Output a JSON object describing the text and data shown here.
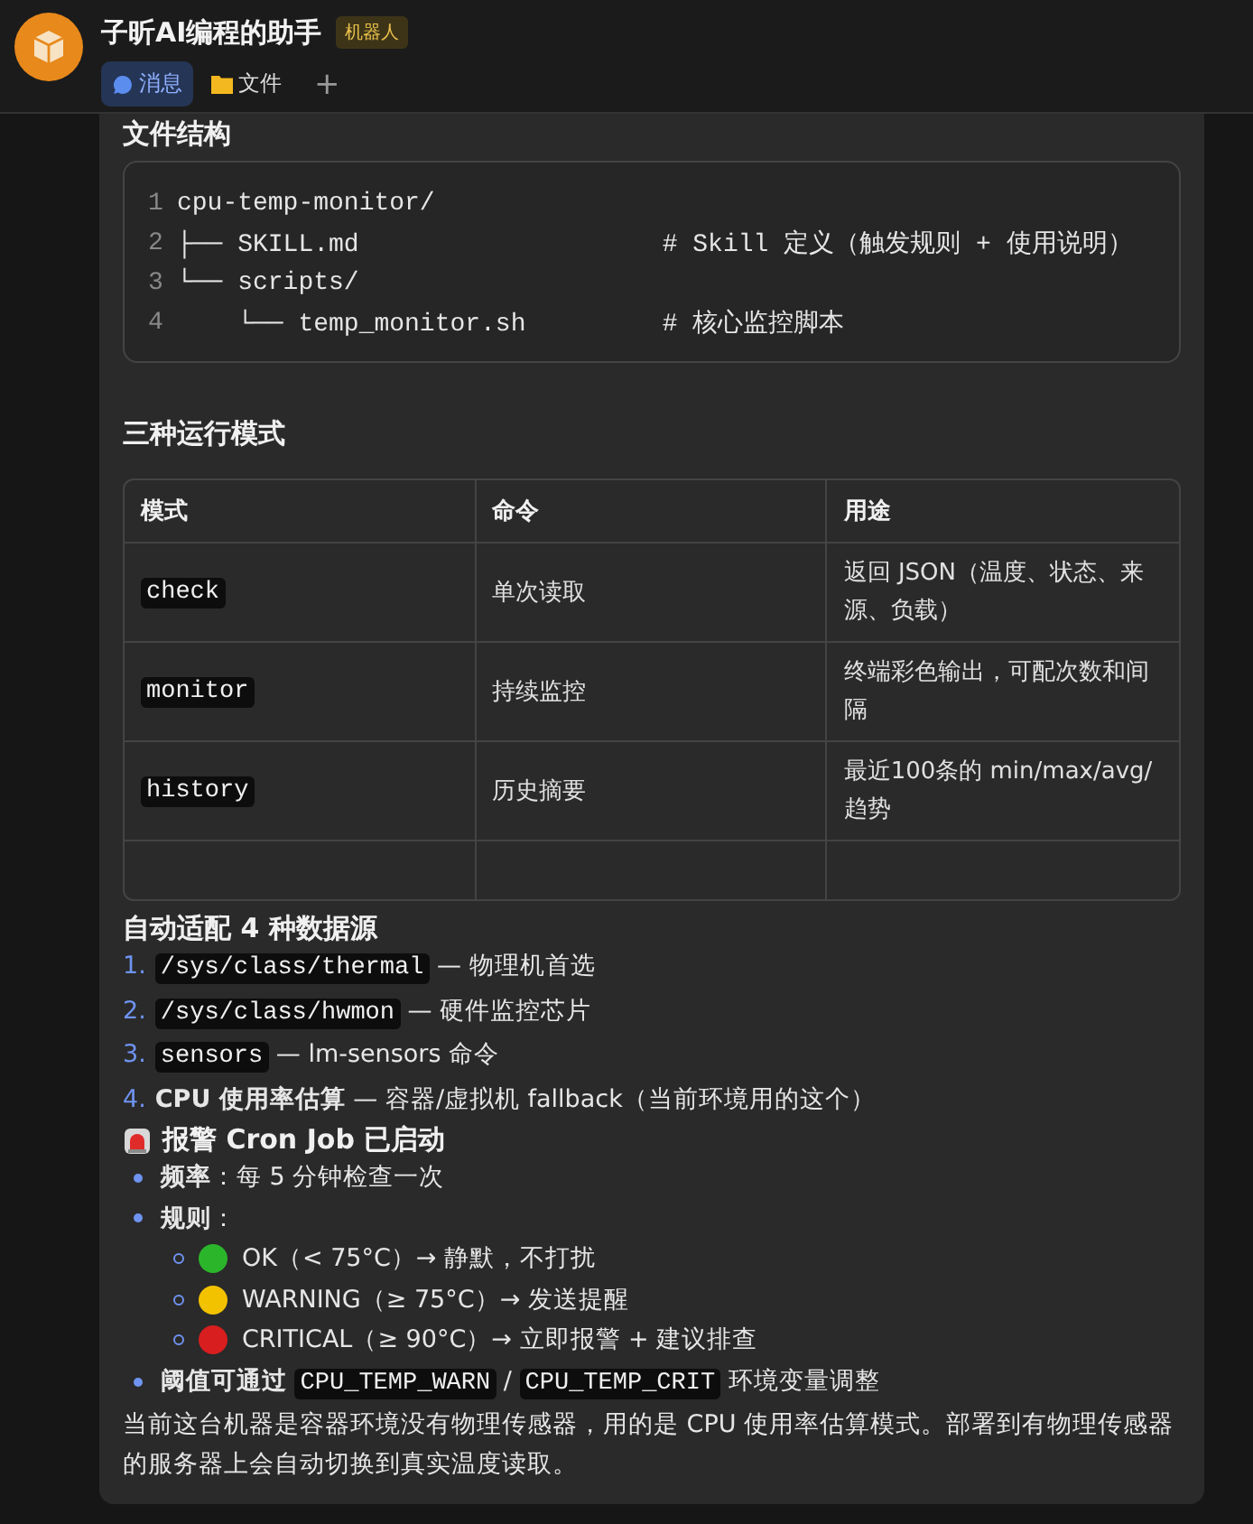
{
  "header": {
    "title": "子昕AI编程的助手",
    "badge": "机器人",
    "tabs": [
      {
        "label": "消息",
        "kind": "chat",
        "selected": true
      },
      {
        "label": "文件",
        "kind": "folder",
        "selected": false
      }
    ],
    "add_tab": "+"
  },
  "file_structure": {
    "heading": "文件结构",
    "lines": [
      {
        "number": "1",
        "text": "cpu-temp-monitor/"
      },
      {
        "number": "2",
        "text": "├── SKILL.md                    # Skill 定义（触发规则 + 使用说明）"
      },
      {
        "number": "3",
        "text": "└── scripts/"
      },
      {
        "number": "4",
        "text": "    └── temp_monitor.sh         # 核心监控脚本"
      }
    ]
  },
  "modes": {
    "heading": "三种运行模式",
    "columns": [
      "模式",
      "命令",
      "用途"
    ],
    "rows": [
      {
        "mode": "check",
        "command": "单次读取",
        "purpose": "返回 JSON（温度、状态、来源、负载）"
      },
      {
        "mode": "monitor",
        "command": "持续监控",
        "purpose": "终端彩色输出，可配次数和间隔"
      },
      {
        "mode": "history",
        "command": "历史摘要",
        "purpose": "最近100条的 min/max/avg/趋势"
      }
    ]
  },
  "sources": {
    "heading": "自动适配 4 种数据源",
    "items": [
      {
        "number": "1.",
        "parts": [
          {
            "kind": "code",
            "text": "/sys/class/thermal"
          },
          {
            "kind": "text",
            "text": " — 物理机首选"
          }
        ]
      },
      {
        "number": "2.",
        "parts": [
          {
            "kind": "code",
            "text": "/sys/class/hwmon"
          },
          {
            "kind": "text",
            "text": " — 硬件监控芯片"
          }
        ]
      },
      {
        "number": "3.",
        "parts": [
          {
            "kind": "code",
            "text": "sensors"
          },
          {
            "kind": "text",
            "text": " — lm-sensors 命令"
          }
        ]
      },
      {
        "number": "4.",
        "parts": [
          {
            "kind": "text",
            "text": "**CPU 使用率估算** — 容器/虚拟机 fallback（当前环境用的这个）"
          }
        ]
      }
    ]
  },
  "alert": {
    "heading": "报警 Cron Job 已启动",
    "items": [
      {
        "parts": [
          {
            "kind": "text",
            "text": "**频率**：每 5 分钟检查一次"
          }
        ]
      },
      {
        "parts": [
          {
            "kind": "text",
            "text": "**规则**："
          }
        ],
        "rules": [
          {
            "color": "#2bb52b",
            "text": "OK（< 75°C）→ 静默，不打扰"
          },
          {
            "color": "#f2c200",
            "text": "WARNING（≥ 75°C）→ 发送提醒"
          },
          {
            "color": "#d81e1e",
            "text": "CRITICAL（≥ 90°C）→ 立即报警 + 建议排查"
          }
        ]
      },
      {
        "parts": [
          {
            "kind": "text",
            "text": "**阈值可通过** "
          },
          {
            "kind": "code",
            "text": "CPU_TEMP_WARN"
          },
          {
            "kind": "text",
            "text": " / "
          },
          {
            "kind": "code",
            "text": "CPU_TEMP_CRIT"
          },
          {
            "kind": "text",
            "text": " 环境变量调整"
          }
        ]
      }
    ]
  },
  "note": "当前这台机器是容器环境没有物理传感器，用的是 CPU 使用率估算模式。部署到有物理传感器的服务器上会自动切换到真实温度读取。"
}
